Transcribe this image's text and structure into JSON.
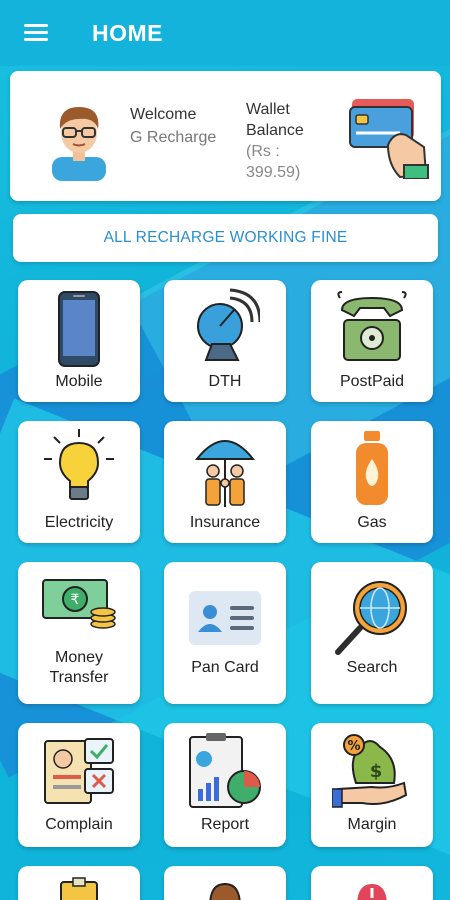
{
  "appbar": {
    "title": "HOME"
  },
  "wallet": {
    "welcome": "Welcome",
    "user": "G Recharge",
    "balance_line1": "Wallet",
    "balance_line2": "Balance",
    "amount_line1": "(Rs :",
    "amount_line2": "399.59)"
  },
  "status": "ALL RECHARGE WORKING FINE",
  "tiles": [
    {
      "label": "Mobile",
      "icon": "mobile-phone-icon"
    },
    {
      "label": "DTH",
      "icon": "satellite-dish-icon"
    },
    {
      "label": "PostPaid",
      "icon": "telephone-icon"
    },
    {
      "label": "Electricity",
      "icon": "light-bulb-icon"
    },
    {
      "label": "Insurance",
      "icon": "family-umbrella-icon"
    },
    {
      "label": "Gas",
      "icon": "gas-cylinder-icon"
    },
    {
      "label_line1": "Money",
      "label_line2": "Transfer",
      "icon": "money-icon"
    },
    {
      "label": "Pan Card",
      "icon": "id-card-icon"
    },
    {
      "label": "Search",
      "icon": "magnifier-globe-icon"
    },
    {
      "label": "Complain",
      "icon": "complaint-form-icon"
    },
    {
      "label": "Report",
      "icon": "report-chart-icon"
    },
    {
      "label": "Margin",
      "icon": "money-bag-hand-icon"
    }
  ],
  "colors": {
    "primary": "#13b3dc",
    "accent_text": "#2a8fd0"
  }
}
